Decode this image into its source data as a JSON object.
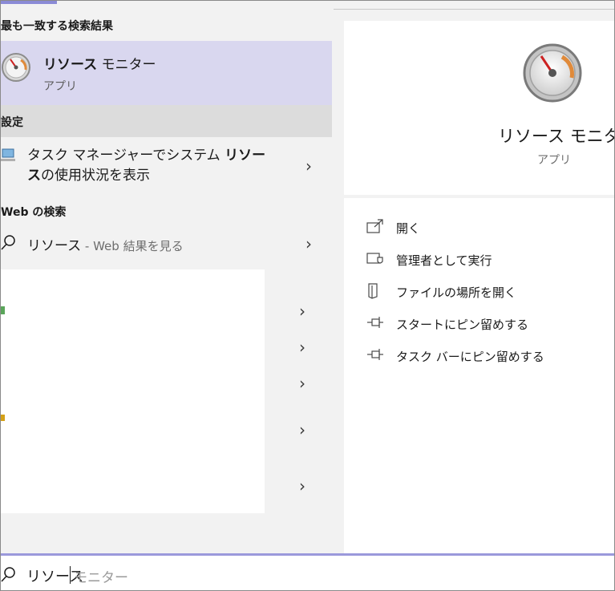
{
  "sections": {
    "best_match_header": "最も一致する検索結果",
    "settings_header": "設定",
    "web_header": "Web の検索"
  },
  "best_match": {
    "title_bold": "リソース",
    "title_rest": " モニター",
    "subtitle": "アプリ",
    "icon": "gauge-icon"
  },
  "settings_result": {
    "text_before": "タスク マネージャーでシステム ",
    "text_bold": "リソース",
    "text_after": "の使用状況を表示",
    "icon": "monitor-icon"
  },
  "web_result": {
    "query": "リソース",
    "suffix": " - Web 結果を見る",
    "icon": "search-icon"
  },
  "right_pane": {
    "app_title": "リソース モニター",
    "app_type": "アプリ",
    "actions": [
      {
        "label": "開く",
        "icon": "open-icon"
      },
      {
        "label": "管理者として実行",
        "icon": "admin-shield-icon"
      },
      {
        "label": "ファイルの場所を開く",
        "icon": "file-location-icon"
      },
      {
        "label": "スタートにピン留めする",
        "icon": "pin-icon"
      },
      {
        "label": "タスク バーにピン留めする",
        "icon": "pin-icon"
      }
    ]
  },
  "search": {
    "typed": "リソース",
    "autocomplete": "モニター",
    "icon": "search-icon"
  },
  "colors": {
    "selected": "#d9d7ef",
    "accent": "#9b99db",
    "gauge_needle": "#cc2222"
  }
}
